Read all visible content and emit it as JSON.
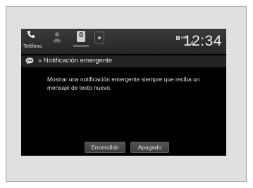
{
  "status_bar": {
    "phone_label": "Teléfono",
    "message_count": "0",
    "time": "12:34"
  },
  "header": {
    "title": "» Notificación emergente"
  },
  "main": {
    "description": "Mostrar una notificación emergente siempre que reciba un mensaje de texto nuevo."
  },
  "options": {
    "on_label": "Encendido",
    "off_label": "Apagado"
  },
  "icons": {
    "phone": "phone-icon",
    "person": "person-icon",
    "messages": "message-badge-icon",
    "home": "home-icon",
    "signal": "signal-icon",
    "chat": "chat-bubble-icon"
  }
}
